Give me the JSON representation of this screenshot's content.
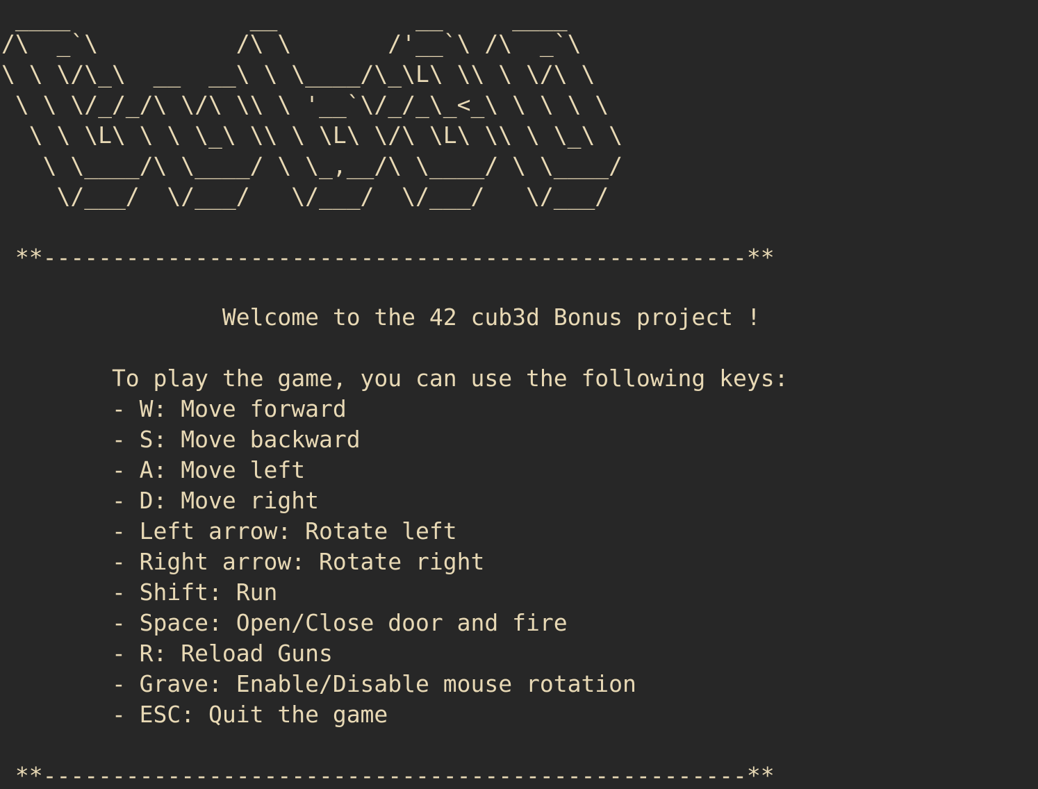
{
  "colors": {
    "background": "#272727",
    "text": "#e8d9b5"
  },
  "banner": {
    "lines": [
      " ____             __          __     ____",
      "/\\  _`\\          /\\ \\       /'__`\\ /\\  _`\\",
      "\\ \\ \\/\\_\\  __  __\\ \\ \\____/\\_\\L\\ \\\\ \\ \\/\\ \\",
      " \\ \\ \\/_/_/\\ \\/\\ \\\\ \\ '__`\\/_/_\\_<_\\ \\ \\ \\ \\",
      "  \\ \\ \\L\\ \\ \\ \\_\\ \\\\ \\ \\L\\ \\/\\ \\L\\ \\\\ \\ \\_\\ \\",
      "   \\ \\____/\\ \\____/ \\ \\_,__/\\ \\____/ \\ \\____/",
      "    \\/___/  \\/___/   \\/___/  \\/___/   \\/___/"
    ]
  },
  "separator_top": " **---------------------------------------------------**",
  "welcome": "                Welcome to the 42 cub3d Bonus project !",
  "intro": "        To play the game, you can use the following keys:",
  "keys": [
    "        - W: Move forward",
    "        - S: Move backward",
    "        - A: Move left",
    "        - D: Move right",
    "        - Left arrow: Rotate left",
    "        - Right arrow: Rotate right",
    "        - Shift: Run",
    "        - Space: Open/Close door and fire",
    "        - R: Reload Guns",
    "        - Grave: Enable/Disable mouse rotation",
    "        - ESC: Quit the game"
  ],
  "separator_bottom": " **---------------------------------------------------**"
}
